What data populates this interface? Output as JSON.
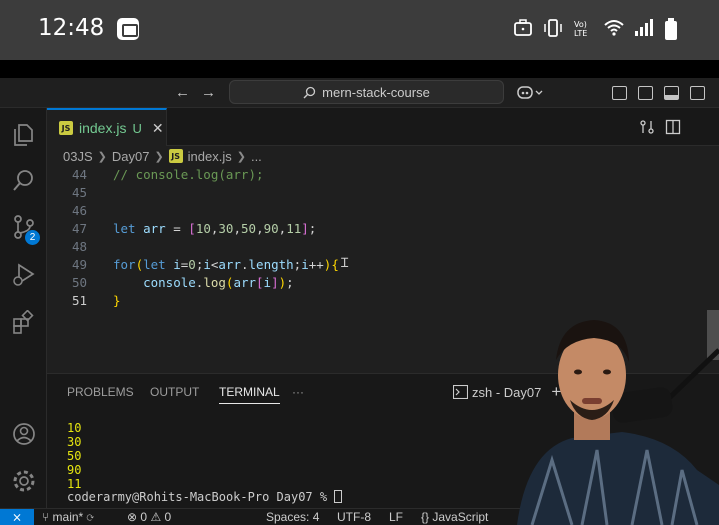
{
  "phone_status": {
    "time": "12:48",
    "network_label": "Vo) LTE"
  },
  "titlebar": {
    "back_arrow": "←",
    "forward_arrow": "→",
    "search_text": "mern-stack-course"
  },
  "activity": {
    "scm_badge": "2"
  },
  "tab": {
    "icon_text": "JS",
    "label": "index.js",
    "status": "U",
    "close": "✕"
  },
  "breadcrumb": {
    "folder1": "03JS",
    "folder2": "Day07",
    "file": "index.js",
    "more": "..."
  },
  "editor": {
    "lines": [
      {
        "n": "44",
        "text": "// console.log(arr);"
      },
      {
        "n": "45",
        "text": ""
      },
      {
        "n": "46",
        "text": ""
      },
      {
        "n": "47",
        "text": "let arr = [10,30,50,90,11];"
      },
      {
        "n": "48",
        "text": ""
      },
      {
        "n": "49",
        "text": "for(let i=0;i<arr.length;i++){"
      },
      {
        "n": "50",
        "text": "    console.log(arr[i]);"
      },
      {
        "n": "51",
        "text": "}"
      }
    ]
  },
  "panel": {
    "tabs": [
      "PROBLEMS",
      "OUTPUT",
      "TERMINAL",
      "···"
    ],
    "terminal_name": "zsh - Day07",
    "add": "+",
    "output": [
      "10",
      "30",
      "50",
      "90",
      "11"
    ],
    "prompt": "coderarmy@Rohits-MacBook-Pro Day07 % "
  },
  "statusbar": {
    "branch": "main*",
    "errors": "0",
    "warnings": "0",
    "spaces": "Spaces: 4",
    "encoding": "UTF-8",
    "eol": "LF",
    "language": "JavaScript"
  },
  "colors": {
    "accent": "#0078d4",
    "js_badge": "#cbcb41",
    "untracked": "#73c991",
    "terminal_output": "#e5e510"
  }
}
